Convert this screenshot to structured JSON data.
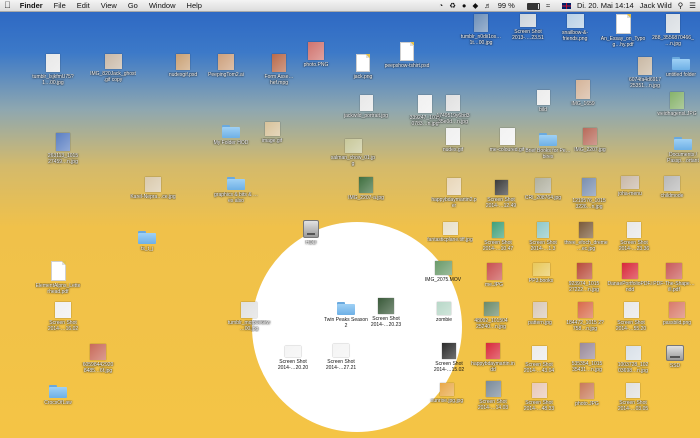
{
  "menubar": {
    "apple": "",
    "app_name": "Finder",
    "menus": [
      "File",
      "Edit",
      "View",
      "Go",
      "Window",
      "Help"
    ],
    "battery": "99 %",
    "clock": "Di. 20. Mai  14:14",
    "user": "Jack Wild"
  },
  "colors": {
    "desktop_top": "#2a64c2",
    "desktop_bottom": "#f4c445",
    "spotlight": "#ffffff"
  },
  "icons": [
    {
      "label": "tumblr_n0dii1os…1t…00.jpg",
      "type": "photo",
      "color": "#6d8fb8"
    },
    {
      "label": "Screen Shot 2013-….23.51",
      "type": "photo",
      "color": "#cbd3db"
    },
    {
      "label": "snailbow-&-friends.png",
      "type": "photo",
      "color": "#b8d0e6"
    },
    {
      "label": "An_Essay_on_Typog…hy.pdf",
      "type": "doc",
      "color": "#ffffff"
    },
    {
      "label": "288_3556870466_…n.jpg",
      "type": "photo",
      "color": "#d8dde2"
    },
    {
      "label": "tumblr_lsjkfmU75?1…00.jpg",
      "type": "photo",
      "color": "#e8e8e8"
    },
    {
      "label": "IMG_820Jack_ghost.gif copy",
      "type": "photo",
      "color": "#c9b8a6"
    },
    {
      "label": "nudesgif.psd",
      "type": "photo",
      "color": "#c9a074"
    },
    {
      "label": "PeepingTom2.ai",
      "type": "photo",
      "color": "#cda07c"
    },
    {
      "label": "Form Asse…hef.mpg",
      "type": "photo",
      "color": "#b96a4a"
    },
    {
      "label": "photo.PNG",
      "type": "photo",
      "color": "#d0736e"
    },
    {
      "label": "jack.png",
      "type": "doc",
      "color": "#ffffff"
    },
    {
      "label": "peepshow-tshirt.psd",
      "type": "doc",
      "color": "#ffffff"
    },
    {
      "label": "6074fa4d6917 25351…n.jpg",
      "type": "photo",
      "color": "#c9b8a3"
    },
    {
      "label": "untitled folder",
      "type": "folder",
      "color": "#7ab8ea"
    },
    {
      "label": "IMG_1659",
      "type": "photo",
      "color": "#d4b49a"
    },
    {
      "label": "jackwild_portrait.jpg",
      "type": "photo",
      "color": "#e8e8e8"
    },
    {
      "label": "339247_1015 0783…n.jpg",
      "type": "photo",
      "color": "#f0f0f0"
    },
    {
      "label": "1749519y6bd3 35e0d…n.jpg",
      "type": "photo",
      "color": "#e0e0e0"
    },
    {
      "label": "bild",
      "type": "photo",
      "color": "#ececec"
    },
    {
      "label": "weidhagensLJPG",
      "type": "photo",
      "color": "#86b26a"
    },
    {
      "label": "263113_1015 27459…n.jpg",
      "type": "photo",
      "color": "#5a7ec2"
    },
    {
      "label": "My Folder HOD",
      "type": "folder",
      "color": "#7ab8ea"
    },
    {
      "label": "image.gif",
      "type": "photo",
      "color": "#d8c29a"
    },
    {
      "label": "salman_chow_01.jpg",
      "type": "photo",
      "color": "#c8c89a"
    },
    {
      "label": "nudes.gif",
      "type": "photo",
      "color": "#f0f0f0"
    },
    {
      "label": "me-coloured.gif",
      "type": "photo",
      "color": "#f2f2f2"
    },
    {
      "label": "Brief Books for Pe…bires",
      "type": "folder",
      "color": "#7ab8ea"
    },
    {
      "label": "IMG_2207.jpg",
      "type": "photo",
      "color": "#b86a5a"
    },
    {
      "label": "Documents / Passp…ortant",
      "type": "folder",
      "color": "#7ab8ea"
    },
    {
      "label": "Karel-Nepra…ce.jpg",
      "type": "photo",
      "color": "#d9c9ac"
    },
    {
      "label": "graphics & bits & …es also",
      "type": "folder",
      "color": "#7ab8ea"
    },
    {
      "label": "IMG_2207-a.jpg",
      "type": "photo",
      "color": "#3f6f3f"
    },
    {
      "label": "happybdaymartin2.per",
      "type": "photo",
      "color": "#e8d6b8"
    },
    {
      "label": "Screen Shot 2014-…12.49",
      "type": "photo",
      "color": "#3b3b3b"
    },
    {
      "label": "CRI_208764.jpg",
      "type": "photo",
      "color": "#b0b0a0"
    },
    {
      "label": "1219576_1015 3226…n.jpg",
      "type": "photo",
      "color": "#7a8fb0"
    },
    {
      "label": "joha-menu",
      "type": "photo",
      "color": "#c8b8a8"
    },
    {
      "label": "childmode",
      "type": "photo",
      "color": "#b8b8b8"
    },
    {
      "label": "HDD",
      "type": "disk",
      "color": "#bdbdbd"
    },
    {
      "label": "fantasticplane.tiff.jpg",
      "type": "photo",
      "color": "#e8e0c8"
    },
    {
      "label": "Screen Shot 2014-…10.47",
      "type": "photo",
      "color": "#3fa07a"
    },
    {
      "label": "Screen Shot 2014-…1.3",
      "type": "photo",
      "color": "#8fc8c8"
    },
    {
      "label": "three_efoch_dreme…ec.jpg",
      "type": "photo",
      "color": "#7a5a3a"
    },
    {
      "label": "Screen Shot 2014-…23.36",
      "type": "photo",
      "color": "#e8e8e8"
    },
    {
      "label": "ts_t_j",
      "type": "folder",
      "color": "#7ab8ea"
    },
    {
      "label": "IMG_2075.MOV",
      "type": "photo",
      "color": "#6a9a6a"
    },
    {
      "label": "me.JPG",
      "type": "photo",
      "color": "#c85050"
    },
    {
      "label": "PP3.books",
      "type": "photo",
      "color": "#e8c85a"
    },
    {
      "label": "923974_1015 27222…n.jpg",
      "type": "photo",
      "color": "#b84a3a"
    },
    {
      "label": "DanaePortfolioPDF.indd",
      "type": "photo",
      "color": "#d8283a"
    },
    {
      "label": "PDF-The-Shape…ill.pdf",
      "type": "photo",
      "color": "#c85a5a"
    },
    {
      "label": "ElementAlpns_Letterhead.pdf",
      "type": "doc",
      "color": "#ffffff"
    },
    {
      "label": "tumblr_mqfp0e6kw…00.jpg",
      "type": "photo",
      "color": "#e0e0e0"
    },
    {
      "label": "Twin Peaks Season 2",
      "type": "folder",
      "color": "#7ab8ea"
    },
    {
      "label": "Screen Shot 2014-…20.23",
      "type": "photo",
      "color": "#3a5a3a"
    },
    {
      "label": "zombie",
      "type": "photo",
      "color": "#b8d8c8"
    },
    {
      "label": "48092_101504 25240…n.jpg",
      "type": "photo",
      "color": "#6a8a6a"
    },
    {
      "label": "pattern.jpg",
      "type": "photo",
      "color": "#d8c8b8"
    },
    {
      "label": "184472_1015 2?758…n.jpg",
      "type": "photo",
      "color": "#d86a4a"
    },
    {
      "label": "Screen Shot 2014-…55.20",
      "type": "photo",
      "color": "#e8e8e8"
    },
    {
      "label": "passbild.png",
      "type": "photo",
      "color": "#d87a6a"
    },
    {
      "label": "Screen Shot 2014-…16.02",
      "type": "photo",
      "color": "#f0f0f0"
    },
    {
      "label": "Screen Shot 2014-…20.20",
      "type": "photo",
      "color": "#f4f4f4"
    },
    {
      "label": "Screen Shot 2014-…27.21",
      "type": "photo",
      "color": "#f4f4f4"
    },
    {
      "label": "Screen Shot 2014-…15.02",
      "type": "photo",
      "color": "#2a2a2a"
    },
    {
      "label": "happybdaymartin.indd",
      "type": "photo",
      "color": "#d8283a"
    },
    {
      "label": "Screen Shot 2014-…43.04",
      "type": "photo",
      "color": "#ececec"
    },
    {
      "label": "535354_1015 35431…n.jpg",
      "type": "photo",
      "color": "#9a8a9a"
    },
    {
      "label": "1003728_102 03698…n.jpg",
      "type": "photo",
      "color": "#d8e0e8"
    },
    {
      "label": "SSD",
      "type": "disk",
      "color": "#bdbdbd"
    },
    {
      "label": "60598442920 8485…6f.jpg",
      "type": "photo",
      "color": "#c86a5a"
    },
    {
      "label": "CrocsOfLaw",
      "type": "folder",
      "color": "#7ab8ea"
    },
    {
      "label": "sunrise.jpg.jpg",
      "type": "photo",
      "color": "#e8a848"
    },
    {
      "label": "Screen Shot 2014-…14.03",
      "type": "photo",
      "color": "#7a8a9a"
    },
    {
      "label": "Screen Shot 2014-…48.33",
      "type": "photo",
      "color": "#e8c8b8"
    },
    {
      "label": "photo.JPG",
      "type": "photo",
      "color": "#c87a5a"
    },
    {
      "label": "Screen Shot 2014-…03.05",
      "type": "photo",
      "color": "#e0e0e0"
    }
  ]
}
